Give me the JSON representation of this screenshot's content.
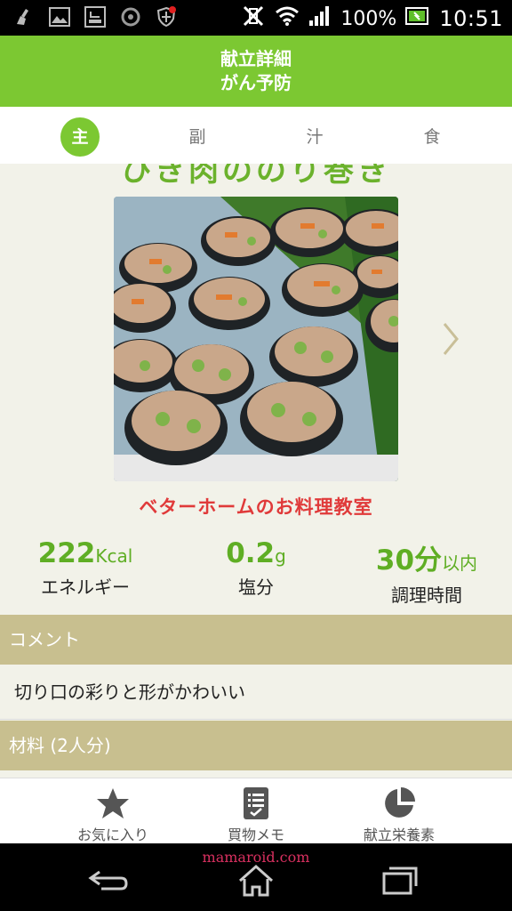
{
  "status_bar": {
    "battery": "100%",
    "time": "10:51"
  },
  "header": {
    "title": "献立詳細",
    "subtitle": "がん予防"
  },
  "tabs": [
    {
      "label": "主",
      "active": true
    },
    {
      "label": "副",
      "active": false
    },
    {
      "label": "汁",
      "active": false
    },
    {
      "label": "食",
      "active": false
    }
  ],
  "recipe": {
    "title": "ひき肉ののり巻き",
    "brand": "ベターホームのお料理教室"
  },
  "stats": [
    {
      "value": "222",
      "unit": "Kcal",
      "label": "エネルギー"
    },
    {
      "value": "0.2",
      "unit": "g",
      "label": "塩分"
    },
    {
      "value": "30分",
      "unit": "以内",
      "label": "調理時間"
    }
  ],
  "sections": {
    "comment_header": "コメント",
    "comment_text": "切り口の彩りと形がかわいい",
    "ingredients_header": "材料 (2人分)"
  },
  "bottom_nav": [
    {
      "label": "お気に入り",
      "icon": "star-icon"
    },
    {
      "label": "買物メモ",
      "icon": "memo-icon"
    },
    {
      "label": "献立栄養素",
      "icon": "pie-chart-icon"
    }
  ],
  "watermark": "mamaroid.com",
  "colors": {
    "accent_green": "#7cc832",
    "section_tan": "#c8bf8f",
    "background": "#f2f2e9",
    "brand_red": "#e03a3a"
  }
}
